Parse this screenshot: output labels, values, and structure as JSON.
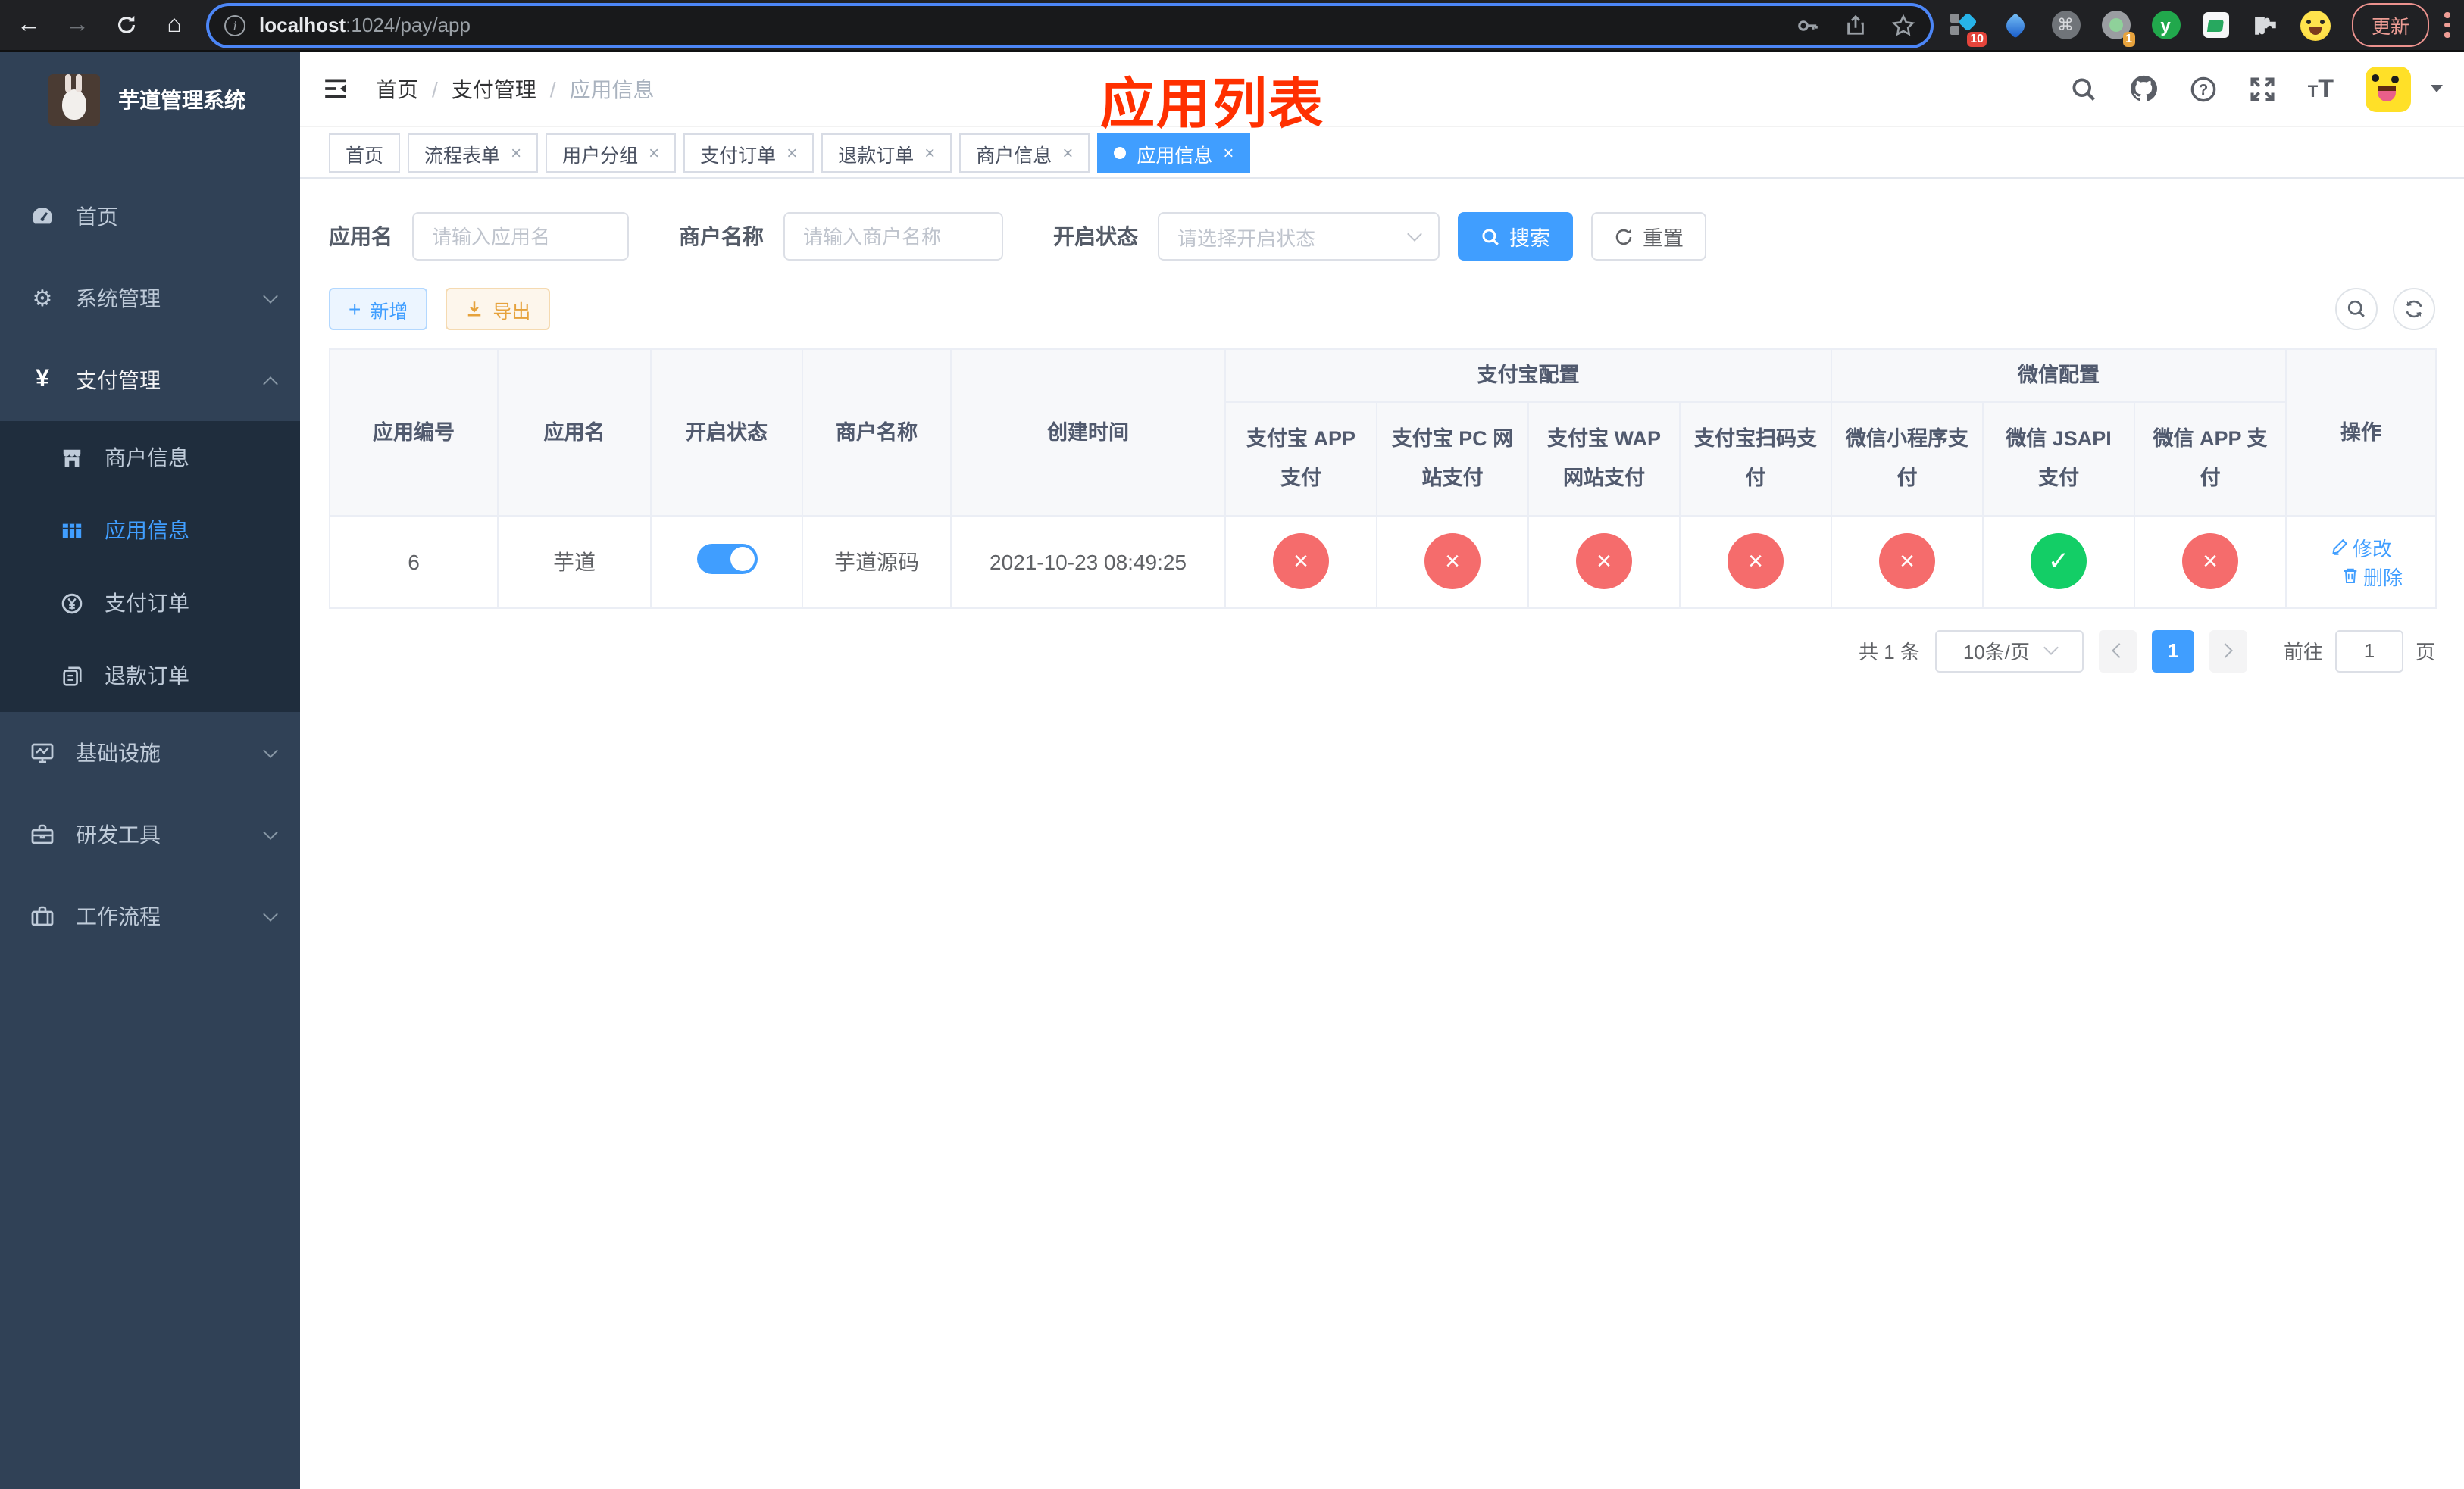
{
  "browser": {
    "url_host": "localhost",
    "url_rest": ":1024/pay/app",
    "update_label": "更新",
    "ext_badges": [
      "10",
      "1"
    ],
    "ext_y_letter": "y",
    "command_glyph": "⌘"
  },
  "sidebar": {
    "title": "芋道管理系统",
    "items": [
      {
        "label": "首页"
      },
      {
        "label": "系统管理"
      },
      {
        "label": "支付管理"
      },
      {
        "label": "基础设施"
      },
      {
        "label": "研发工具"
      },
      {
        "label": "工作流程"
      }
    ],
    "submenu": [
      {
        "label": "商户信息"
      },
      {
        "label": "应用信息"
      },
      {
        "label": "支付订单"
      },
      {
        "label": "退款订单"
      }
    ]
  },
  "header": {
    "breadcrumb": [
      "首页",
      "支付管理",
      "应用信息"
    ],
    "annotation": "应用列表"
  },
  "tabs": [
    {
      "label": "首页"
    },
    {
      "label": "流程表单"
    },
    {
      "label": "用户分组"
    },
    {
      "label": "支付订单"
    },
    {
      "label": "退款订单"
    },
    {
      "label": "商户信息"
    },
    {
      "label": "应用信息"
    }
  ],
  "filters": {
    "app_name_label": "应用名",
    "app_name_placeholder": "请输入应用名",
    "merchant_label": "商户名称",
    "merchant_placeholder": "请输入商户名称",
    "status_label": "开启状态",
    "status_placeholder": "请选择开启状态",
    "search_label": "搜索",
    "reset_label": "重置"
  },
  "toolbar": {
    "add_label": "新增",
    "export_label": "导出"
  },
  "table": {
    "columns": {
      "app_id": "应用编号",
      "app_name": "应用名",
      "enabled": "开启状态",
      "merchant": "商户名称",
      "created": "创建时间",
      "actions": "操作"
    },
    "groups": {
      "alipay": "支付宝配置",
      "wechat": "微信配置"
    },
    "sub_columns": [
      "支付宝 APP 支付",
      "支付宝 PC 网站支付",
      "支付宝 WAP 网站支付",
      "支付宝扫码支付",
      "微信小程序支付",
      "微信 JSAPI 支付",
      "微信 APP 支付"
    ],
    "rows": [
      {
        "app_id": "6",
        "app_name": "芋道",
        "enabled": true,
        "merchant": "芋道源码",
        "created": "2021-10-23 08:49:25",
        "statuses": [
          false,
          false,
          false,
          false,
          false,
          true,
          false
        ],
        "edit_label": "修改",
        "delete_label": "删除"
      }
    ]
  },
  "pagination": {
    "total": "共 1 条",
    "page_size": "10条/页",
    "current_page": "1",
    "goto_label": "前往",
    "goto_value": "1",
    "unit_label": "页"
  },
  "icons": {
    "check": "✓",
    "cross": "×",
    "close": "×",
    "back": "←",
    "forward": "→",
    "home": "⌂",
    "gear": "⚙",
    "yen": "¥",
    "plus": "+",
    "question": "?",
    "font_big": "T",
    "font_small": "T",
    "info": "i"
  },
  "colors": {
    "accent": "#409eff",
    "danger": "#f56c6c",
    "success": "#13ce66",
    "warning": "#e6a23c",
    "annotation_red": "#ff3000",
    "sidebar_bg": "#304156",
    "submenu_bg": "#1f2d3d"
  }
}
